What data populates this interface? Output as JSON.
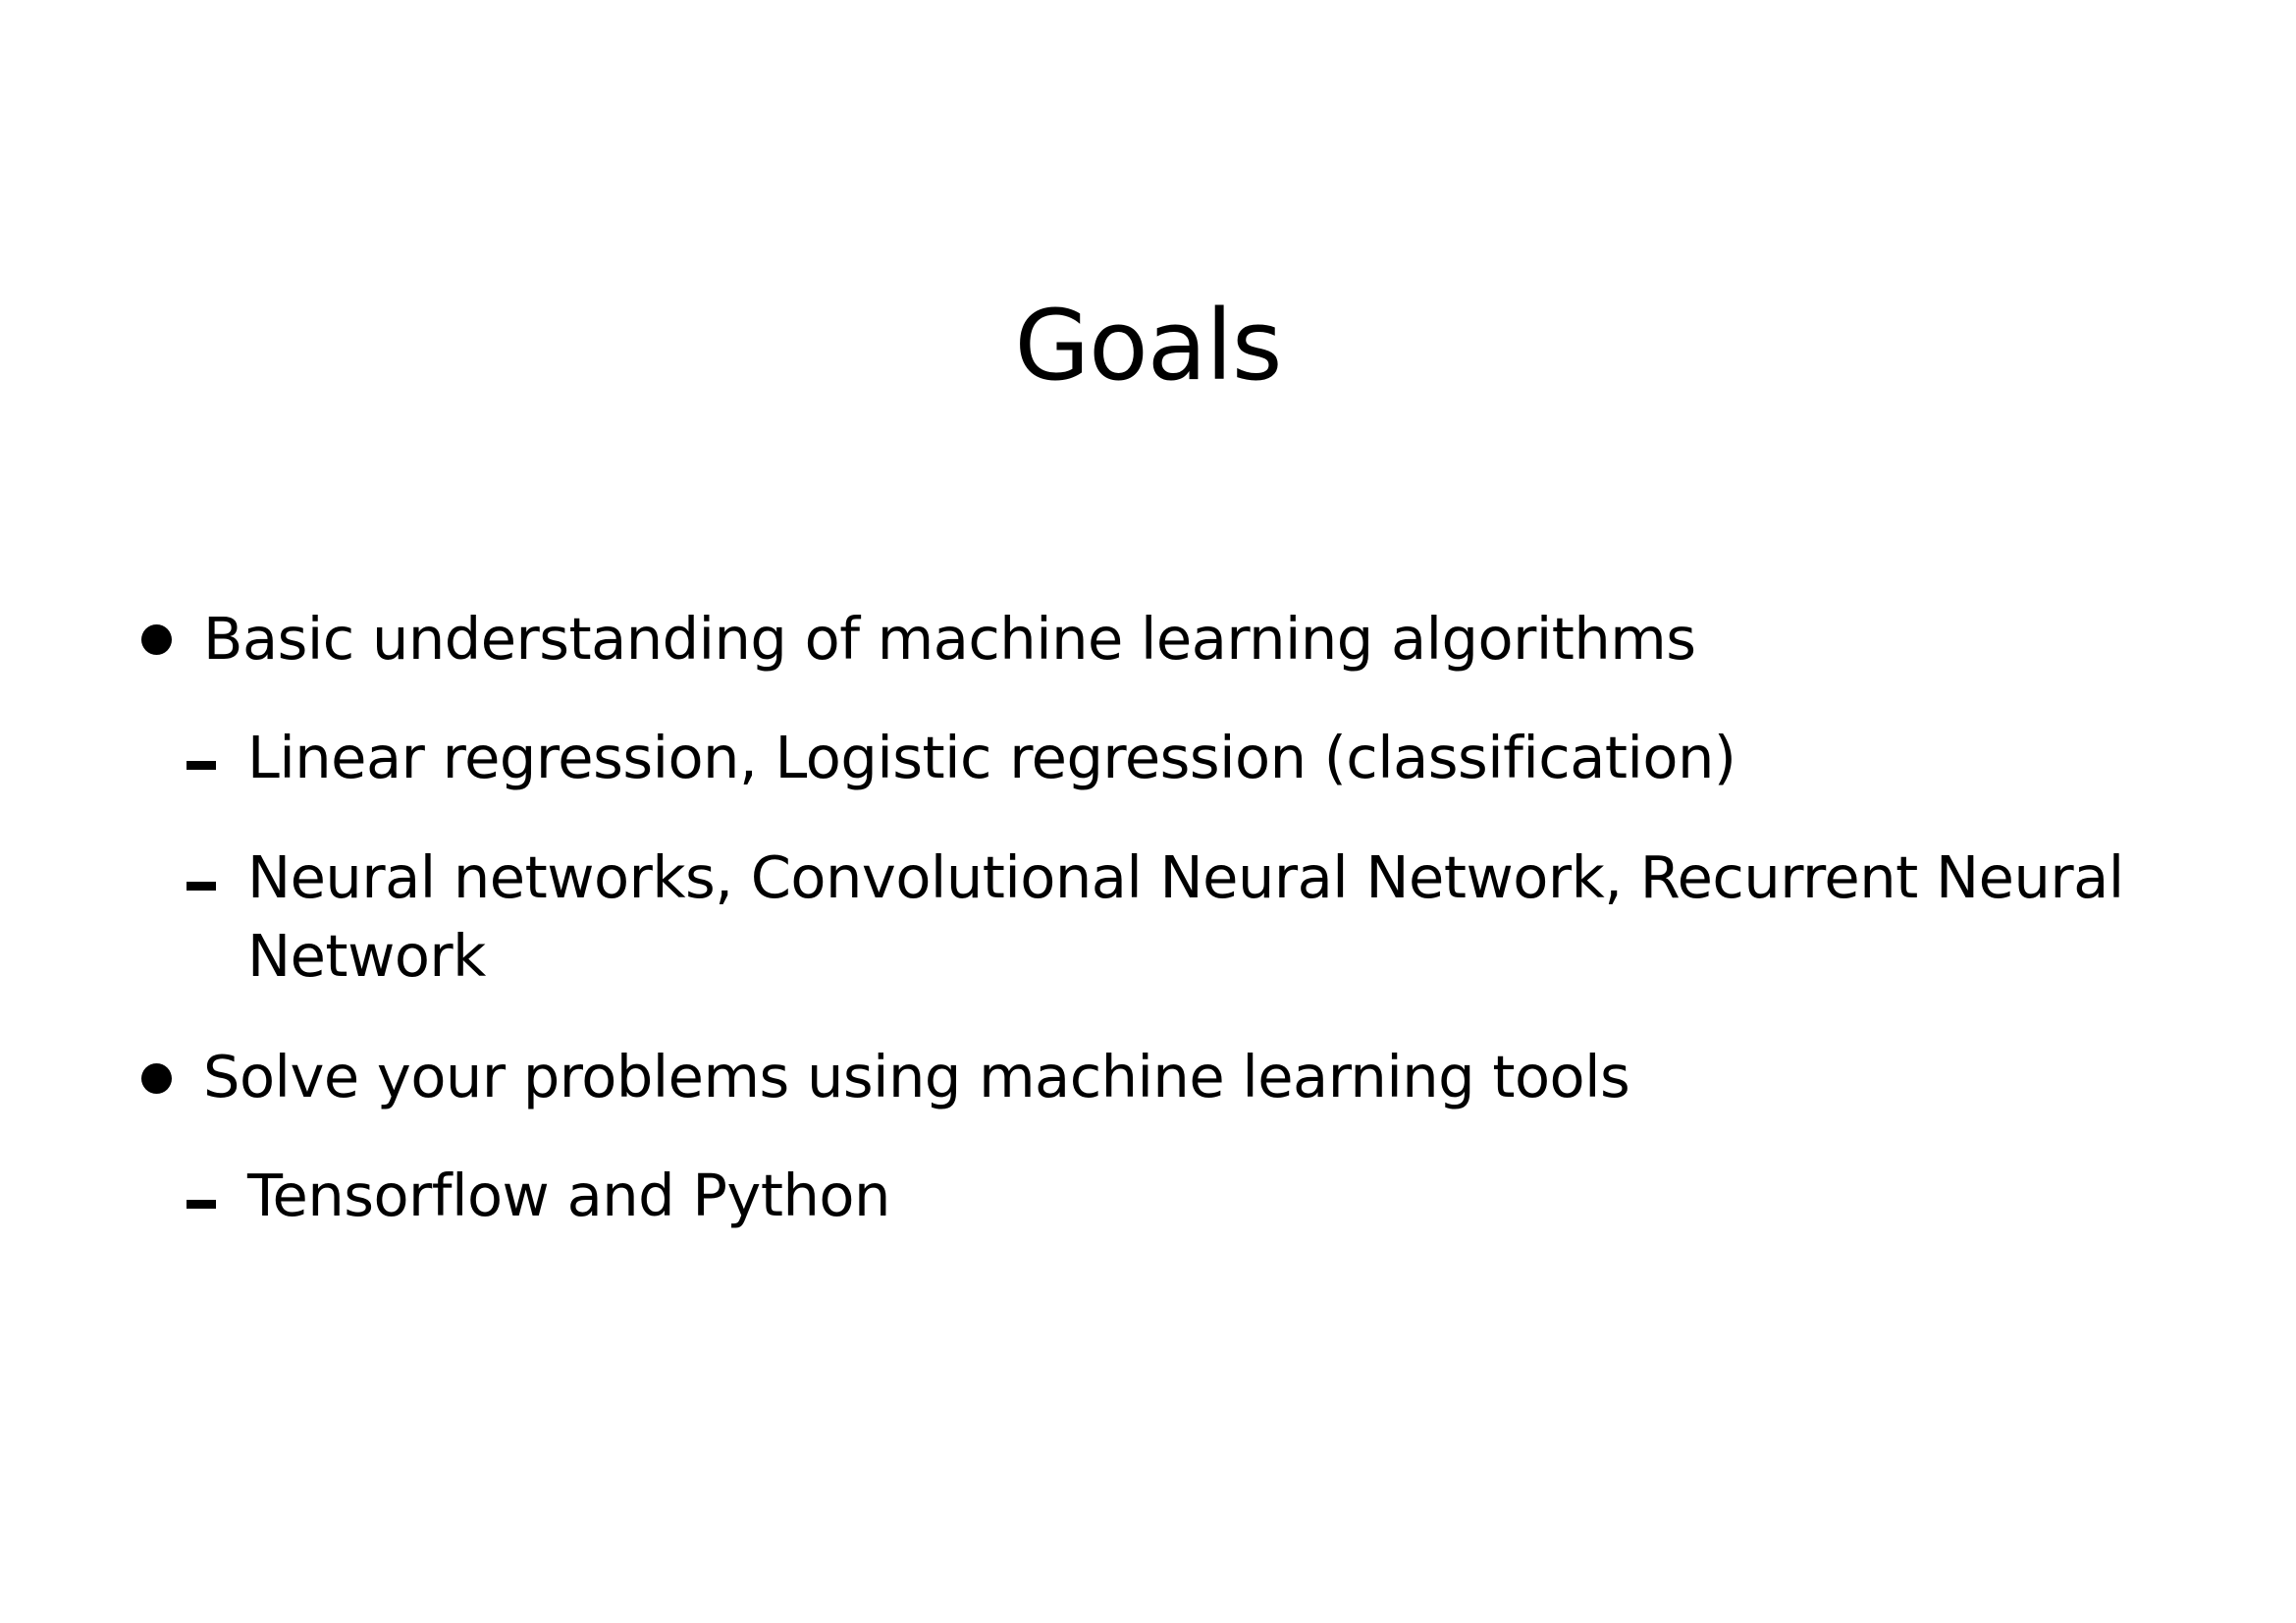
{
  "slide": {
    "title": "Goals",
    "bullets": [
      {
        "text": "Basic understanding of machine learning algorithms",
        "subitems": [
          {
            "lines": [
              "Linear regression, Logistic regression (classification)"
            ]
          },
          {
            "lines": [
              "Neural networks, Convolutional Neural Network, Recurrent Neural",
              "Network"
            ]
          }
        ]
      },
      {
        "text": "Solve your problems using machine learning tools",
        "subitems": [
          {
            "lines": [
              "Tensorflow and Python"
            ]
          }
        ]
      }
    ]
  }
}
